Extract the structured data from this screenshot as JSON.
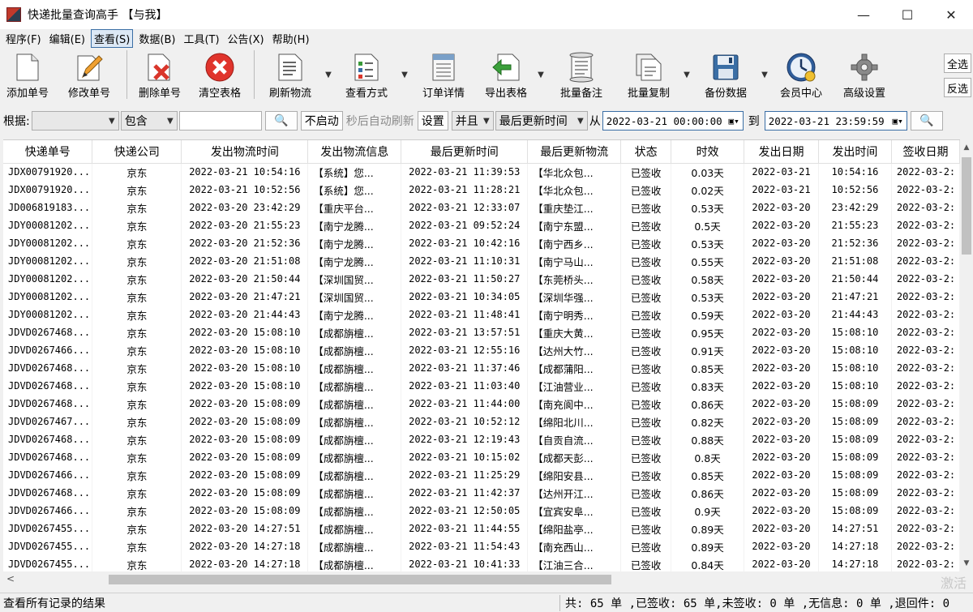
{
  "window": {
    "title": "快递批量查询高手 【与我】",
    "minimize": "—",
    "maximize": "☐",
    "close": "✕"
  },
  "menu": [
    {
      "label": "程序(F)"
    },
    {
      "label": "编辑(E)"
    },
    {
      "label": "查看(S)"
    },
    {
      "label": "数据(B)"
    },
    {
      "label": "工具(T)"
    },
    {
      "label": "公告(X)"
    },
    {
      "label": "帮助(H)"
    }
  ],
  "toolbar": {
    "add": "添加单号",
    "edit": "修改单号",
    "delete": "删除单号",
    "clear": "清空表格",
    "refresh": "刷新物流",
    "view_mode": "查看方式",
    "order_detail": "订单详情",
    "export": "导出表格",
    "batch_note": "批量备注",
    "batch_copy": "批量复制",
    "backup": "备份数据",
    "member": "会员中心",
    "advanced": "高级设置",
    "select_all": "全选",
    "invert": "反选"
  },
  "filter": {
    "basis_label": "根据:",
    "basis_value": "",
    "match_value": "包含",
    "keyword": "",
    "auto_toggle": "不启动",
    "auto_hint": "秒后自动刷新",
    "settings": "设置",
    "logic": "并且",
    "time_field": "最后更新时间",
    "from_label": "从",
    "from_date": "2022-03-21 00:00:00",
    "to_label": "到",
    "to_date": "2022-03-21 23:59:59"
  },
  "table": {
    "columns": [
      "快递单号",
      "快递公司",
      "发出物流时间",
      "发出物流信息",
      "最后更新时间",
      "最后更新物流",
      "状态",
      "时效",
      "发出日期",
      "发出时间",
      "签收日期"
    ],
    "rows": [
      [
        "JDX00791920...",
        "京东",
        "2022-03-21 10:54:16",
        "【系统】您...",
        "2022-03-21 11:39:53",
        "【华北众包...",
        "已签收",
        "0.03天",
        "2022-03-21",
        "10:54:16",
        "2022-03-2:"
      ],
      [
        "JDX00791920...",
        "京东",
        "2022-03-21 10:52:56",
        "【系统】您...",
        "2022-03-21 11:28:21",
        "【华北众包...",
        "已签收",
        "0.02天",
        "2022-03-21",
        "10:52:56",
        "2022-03-2:"
      ],
      [
        "JD006819183...",
        "京东",
        "2022-03-20 23:42:29",
        "【重庆平台...",
        "2022-03-21 12:33:07",
        "【重庆垫江...",
        "已签收",
        "0.53天",
        "2022-03-20",
        "23:42:29",
        "2022-03-2:"
      ],
      [
        "JDY00081202...",
        "京东",
        "2022-03-20 21:55:23",
        "【南宁龙腾...",
        "2022-03-21 09:52:24",
        "【南宁东盟...",
        "已签收",
        "0.5天",
        "2022-03-20",
        "21:55:23",
        "2022-03-2:"
      ],
      [
        "JDY00081202...",
        "京东",
        "2022-03-20 21:52:36",
        "【南宁龙腾...",
        "2022-03-21 10:42:16",
        "【南宁西乡...",
        "已签收",
        "0.53天",
        "2022-03-20",
        "21:52:36",
        "2022-03-2:"
      ],
      [
        "JDY00081202...",
        "京东",
        "2022-03-20 21:51:08",
        "【南宁龙腾...",
        "2022-03-21 11:10:31",
        "【南宁马山...",
        "已签收",
        "0.55天",
        "2022-03-20",
        "21:51:08",
        "2022-03-2:"
      ],
      [
        "JDY00081202...",
        "京东",
        "2022-03-20 21:50:44",
        "【深圳国贸...",
        "2022-03-21 11:50:27",
        "【东莞桥头...",
        "已签收",
        "0.58天",
        "2022-03-20",
        "21:50:44",
        "2022-03-2:"
      ],
      [
        "JDY00081202...",
        "京东",
        "2022-03-20 21:47:21",
        "【深圳国贸...",
        "2022-03-21 10:34:05",
        "【深圳华强...",
        "已签收",
        "0.53天",
        "2022-03-20",
        "21:47:21",
        "2022-03-2:"
      ],
      [
        "JDY00081202...",
        "京东",
        "2022-03-20 21:44:43",
        "【南宁龙腾...",
        "2022-03-21 11:48:41",
        "【南宁明秀...",
        "已签收",
        "0.59天",
        "2022-03-20",
        "21:44:43",
        "2022-03-2:"
      ],
      [
        "JDVD0267468...",
        "京东",
        "2022-03-20 15:08:10",
        "【成都旃檀...",
        "2022-03-21 13:57:51",
        "【重庆大黄...",
        "已签收",
        "0.95天",
        "2022-03-20",
        "15:08:10",
        "2022-03-2:"
      ],
      [
        "JDVD0267466...",
        "京东",
        "2022-03-20 15:08:10",
        "【成都旃檀...",
        "2022-03-21 12:55:16",
        "【达州大竹...",
        "已签收",
        "0.91天",
        "2022-03-20",
        "15:08:10",
        "2022-03-2:"
      ],
      [
        "JDVD0267468...",
        "京东",
        "2022-03-20 15:08:10",
        "【成都旃檀...",
        "2022-03-21 11:37:46",
        "【成都蒲阳...",
        "已签收",
        "0.85天",
        "2022-03-20",
        "15:08:10",
        "2022-03-2:"
      ],
      [
        "JDVD0267468...",
        "京东",
        "2022-03-20 15:08:10",
        "【成都旃檀...",
        "2022-03-21 11:03:40",
        "【江油营业...",
        "已签收",
        "0.83天",
        "2022-03-20",
        "15:08:10",
        "2022-03-2:"
      ],
      [
        "JDVD0267468...",
        "京东",
        "2022-03-20 15:08:09",
        "【成都旃檀...",
        "2022-03-21 11:44:00",
        "【南充阆中...",
        "已签收",
        "0.86天",
        "2022-03-20",
        "15:08:09",
        "2022-03-2:"
      ],
      [
        "JDVD0267467...",
        "京东",
        "2022-03-20 15:08:09",
        "【成都旃檀...",
        "2022-03-21 10:52:12",
        "【绵阳北川...",
        "已签收",
        "0.82天",
        "2022-03-20",
        "15:08:09",
        "2022-03-2:"
      ],
      [
        "JDVD0267468...",
        "京东",
        "2022-03-20 15:08:09",
        "【成都旃檀...",
        "2022-03-21 12:19:43",
        "【自贡自流...",
        "已签收",
        "0.88天",
        "2022-03-20",
        "15:08:09",
        "2022-03-2:"
      ],
      [
        "JDVD0267468...",
        "京东",
        "2022-03-20 15:08:09",
        "【成都旃檀...",
        "2022-03-21 10:15:02",
        "【成都天彭...",
        "已签收",
        "0.8天",
        "2022-03-20",
        "15:08:09",
        "2022-03-2:"
      ],
      [
        "JDVD0267466...",
        "京东",
        "2022-03-20 15:08:09",
        "【成都旃檀...",
        "2022-03-21 11:25:29",
        "【绵阳安县...",
        "已签收",
        "0.85天",
        "2022-03-20",
        "15:08:09",
        "2022-03-2:"
      ],
      [
        "JDVD0267468...",
        "京东",
        "2022-03-20 15:08:09",
        "【成都旃檀...",
        "2022-03-21 11:42:37",
        "【达州开江...",
        "已签收",
        "0.86天",
        "2022-03-20",
        "15:08:09",
        "2022-03-2:"
      ],
      [
        "JDVD0267466...",
        "京东",
        "2022-03-20 15:08:09",
        "【成都旃檀...",
        "2022-03-21 12:50:05",
        "【宜宾安阜...",
        "已签收",
        "0.9天",
        "2022-03-20",
        "15:08:09",
        "2022-03-2:"
      ],
      [
        "JDVD0267455...",
        "京东",
        "2022-03-20 14:27:51",
        "【成都旃檀...",
        "2022-03-21 11:44:55",
        "【绵阳盐亭...",
        "已签收",
        "0.89天",
        "2022-03-20",
        "14:27:51",
        "2022-03-2:"
      ],
      [
        "JDVD0267455...",
        "京东",
        "2022-03-20 14:27:18",
        "【成都旃檀...",
        "2022-03-21 11:54:43",
        "【南充西山...",
        "已签收",
        "0.89天",
        "2022-03-20",
        "14:27:18",
        "2022-03-2:"
      ],
      [
        "JDVD0267455...",
        "京东",
        "2022-03-20 14:27:18",
        "【成都旃檀...",
        "2022-03-21 10:41:33",
        "【江油三合...",
        "已签收",
        "0.84天",
        "2022-03-20",
        "14:27:18",
        "2022-03-2:"
      ]
    ]
  },
  "watermark": "激活",
  "status": {
    "left": "查看所有记录的结果",
    "right": "共: 65 单 ,已签收: 65 单,未签收: 0 单 ,无信息: 0 单 ,退回件: 0"
  },
  "colors": {
    "accent": "#3a6ea5",
    "delete_red": "#d9362b"
  }
}
